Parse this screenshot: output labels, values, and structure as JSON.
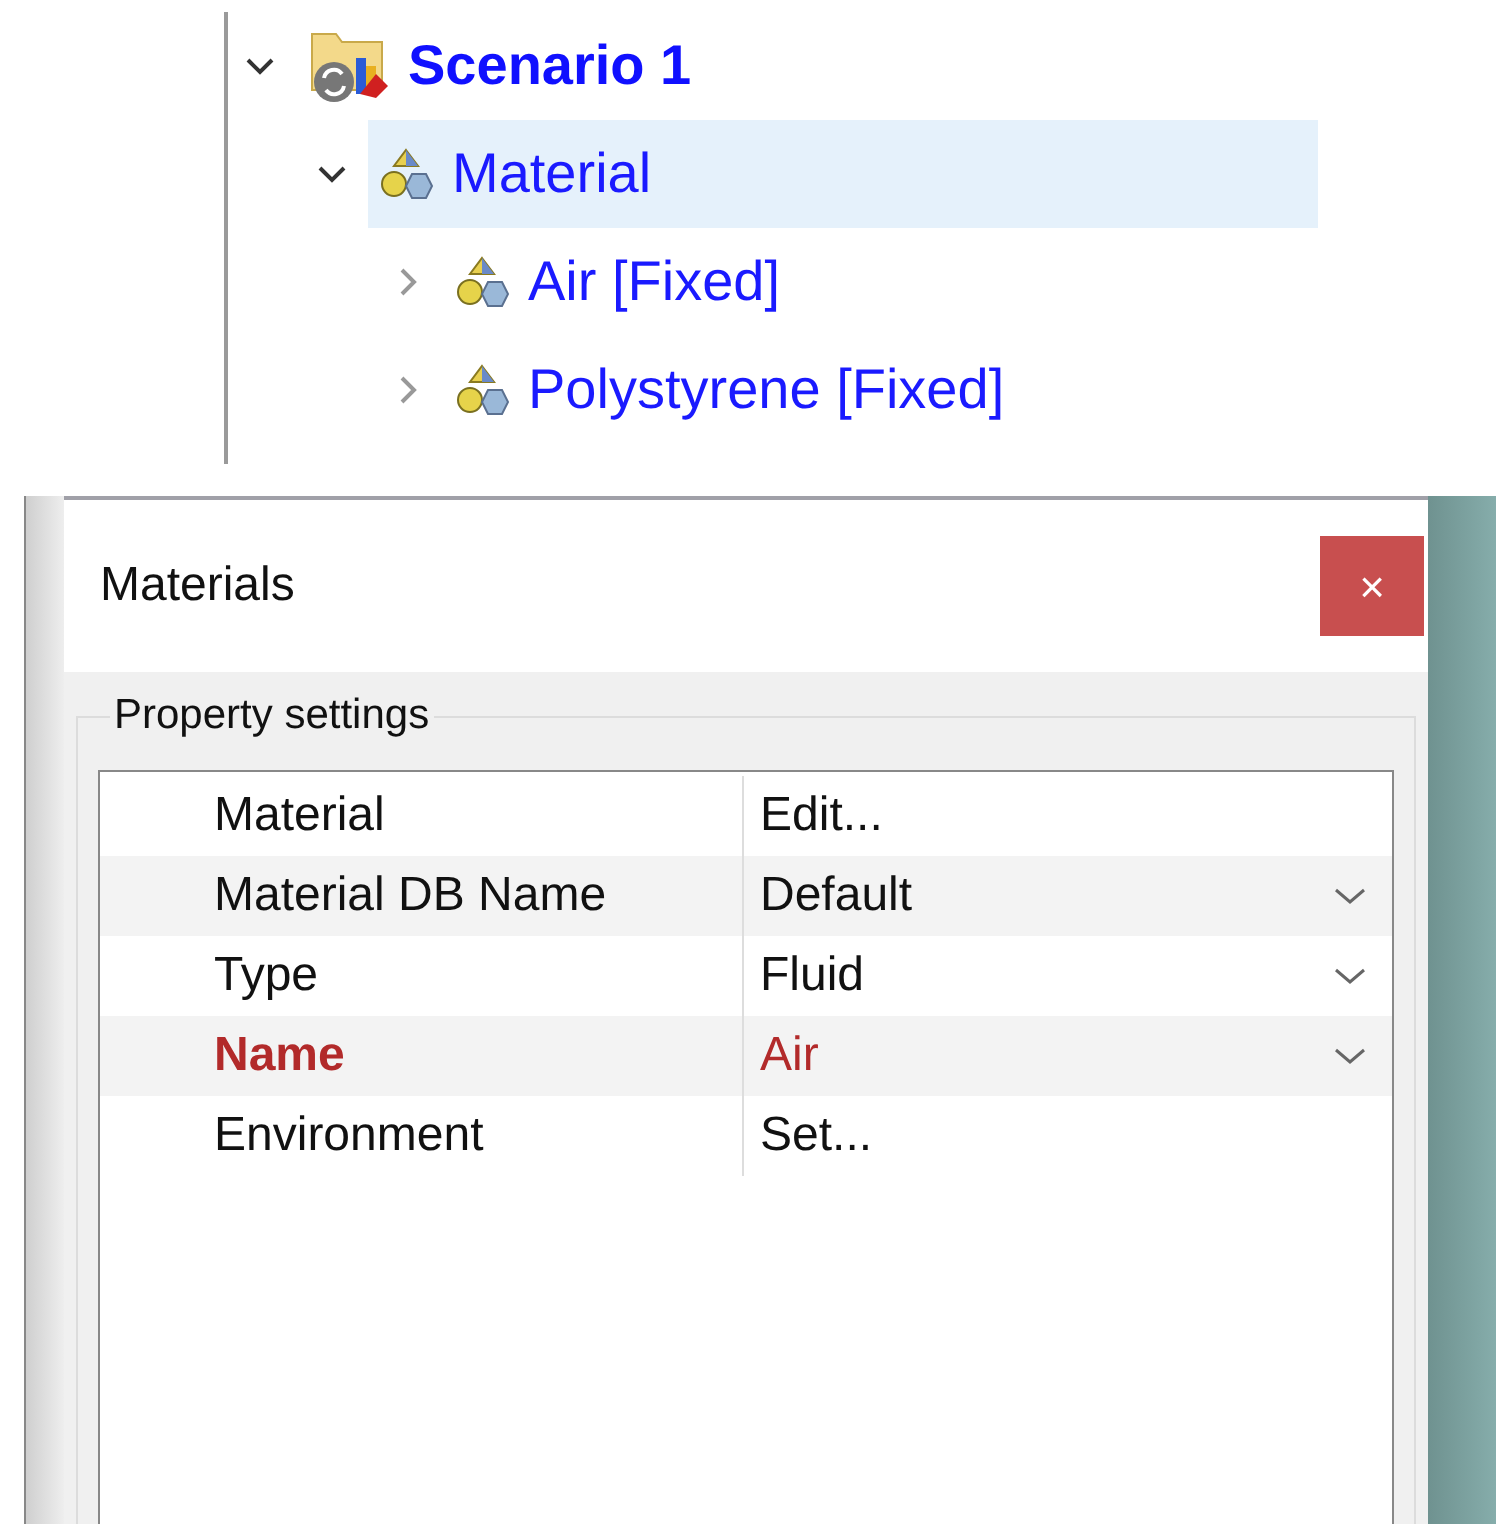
{
  "tree": [
    {
      "label": "Scenario 1",
      "kind": "scenario",
      "expanded": true,
      "selected": false,
      "children": [
        {
          "label": "Material",
          "kind": "material",
          "expanded": true,
          "selected": true,
          "children": [
            {
              "label": "Air [Fixed]",
              "kind": "material",
              "expanded": false,
              "selected": false
            },
            {
              "label": "Polystyrene [Fixed]",
              "kind": "material",
              "expanded": false,
              "selected": false
            }
          ]
        }
      ]
    }
  ],
  "dialog": {
    "title": "Materials",
    "close": "×",
    "group": "Property settings",
    "properties": [
      {
        "label": "Material",
        "value": "Edit...",
        "kind": "button",
        "emphasized": false
      },
      {
        "label": "Material DB Name",
        "value": "Default",
        "kind": "dropdown",
        "emphasized": false
      },
      {
        "label": "Type",
        "value": "Fluid",
        "kind": "dropdown",
        "emphasized": false
      },
      {
        "label": "Name",
        "value": "Air",
        "kind": "dropdown",
        "emphasized": true
      },
      {
        "label": "Environment",
        "value": "Set...",
        "kind": "button",
        "emphasized": false
      }
    ]
  }
}
